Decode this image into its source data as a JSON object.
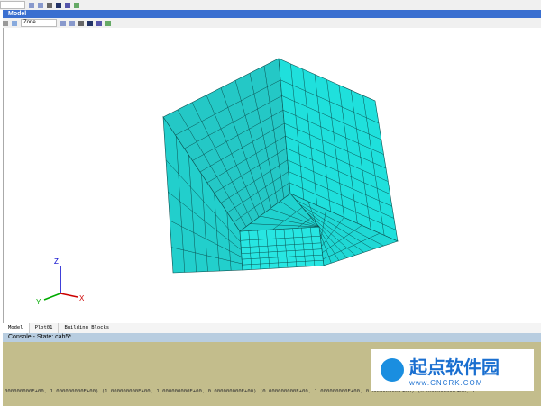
{
  "window": {
    "title": "Model"
  },
  "toolbar": {
    "zone_select": "Zone"
  },
  "tabs": [
    {
      "label": "Model"
    },
    {
      "label": "Plot01"
    },
    {
      "label": "Building Blocks"
    }
  ],
  "console": {
    "title": "Console - State: cab5*",
    "line": "000000000E+00, 1.000000000E+00) (1.000000000E+00, 1.000000000E+00, 0.000000000E+00) (0.000000000E+00, 1.000000000E+00, 0.000000000E+00) (0.000000000E+00, 1"
  },
  "axes": {
    "z": "Z",
    "y": "Y",
    "x": "X"
  },
  "colors": {
    "mesh": "#1fd3d0",
    "edge": "#0b5050"
  },
  "watermark": {
    "name": "起点软件园",
    "url": "www.CNCRK.COM"
  }
}
